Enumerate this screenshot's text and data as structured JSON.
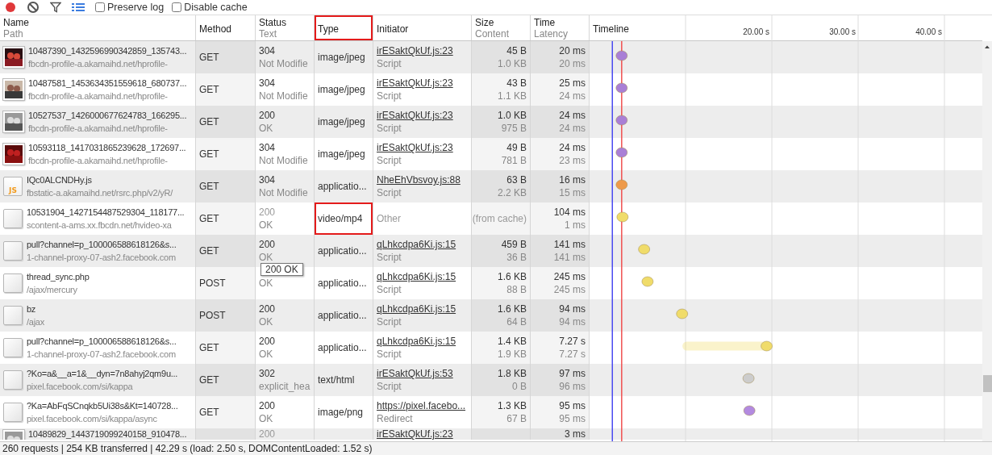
{
  "toolbar": {
    "record": {
      "on": true
    },
    "checkboxes": [
      {
        "label": "Preserve log",
        "checked": false
      },
      {
        "label": "Disable cache",
        "checked": false
      }
    ]
  },
  "columns": [
    {
      "label": "Name",
      "sublabel": "Path",
      "highlighted": false
    },
    {
      "label": "Method",
      "highlighted": false
    },
    {
      "label": "Status",
      "sublabel": "Text",
      "highlighted": false
    },
    {
      "label": "Type",
      "highlighted": true
    },
    {
      "label": "Initiator",
      "highlighted": false
    },
    {
      "label": "Size",
      "sublabel": "Content",
      "highlighted": false
    },
    {
      "label": "Time",
      "sublabel": "Latency",
      "highlighted": false
    },
    {
      "label": "Timeline",
      "highlighted": false
    }
  ],
  "rows": [
    {
      "name": "10487390_1432596990342859_135743...",
      "path": "fbcdn-profile-a.akamaihd.net/hprofile-",
      "method": "GET",
      "status": "304",
      "status_text": "Not Modifie",
      "type": {
        "text": "image/jpeg",
        "highlighted": false
      },
      "initiator": {
        "text": "irESaktQkUf.js:23",
        "link": true
      },
      "initiator_type": "Script",
      "size": "45 B",
      "content": "1.0 KB",
      "time": "20 ms",
      "latency": "20 ms",
      "cached": false,
      "color": "#a97fd6"
    },
    {
      "name": "10487581_1453634351559618_680737...",
      "path": "fbcdn-profile-a.akamaihd.net/hprofile-",
      "method": "GET",
      "status": "304",
      "status_text": "Not Modifie",
      "type": {
        "text": "image/jpeg",
        "highlighted": false
      },
      "initiator": {
        "text": "irESaktQkUf.js:23",
        "link": true
      },
      "initiator_type": "Script",
      "size": "43 B",
      "content": "1.1 KB",
      "time": "25 ms",
      "latency": "24 ms",
      "cached": false,
      "color": "#a97fd6"
    },
    {
      "name": "10527537_1426000677624783_166295...",
      "path": "fbcdn-profile-a.akamaihd.net/hprofile-",
      "method": "GET",
      "status": "200",
      "status_text": "OK",
      "type": {
        "text": "image/jpeg",
        "highlighted": false
      },
      "initiator": {
        "text": "irESaktQkUf.js:23",
        "link": true
      },
      "initiator_type": "Script",
      "size": "1.0 KB",
      "content": "975 B",
      "time": "24 ms",
      "latency": "24 ms",
      "cached": false,
      "color": "#a97fd6"
    },
    {
      "name": "10593118_1417031865239628_172697...",
      "path": "fbcdn-profile-a.akamaihd.net/hprofile-",
      "method": "GET",
      "status": "304",
      "status_text": "Not Modifie",
      "type": {
        "text": "image/jpeg",
        "highlighted": false
      },
      "initiator": {
        "text": "irESaktQkUf.js:23",
        "link": true
      },
      "initiator_type": "Script",
      "size": "49 B",
      "content": "781 B",
      "time": "24 ms",
      "latency": "23 ms",
      "cached": false,
      "color": "#a97fd6"
    },
    {
      "thumb": {
        "kind": "script",
        "label": "JS"
      },
      "name": "IQc0ALCNDHy.js",
      "path": "fbstatic-a.akamaihd.net/rsrc.php/v2/yR/",
      "method": "GET",
      "status": "304",
      "status_text": "Not Modifie",
      "type": {
        "text": "applicatio...",
        "highlighted": false
      },
      "initiator": {
        "text": "NheEhVbsvoy.js:88",
        "link": true
      },
      "initiator_type": "Script",
      "size": "63 B",
      "content": "2.2 KB",
      "time": "16 ms",
      "latency": "15 ms",
      "cached": false,
      "color": "#ee9a4a"
    },
    {
      "thumb": {
        "kind": "blank"
      },
      "name": "10531904_1427154487529304_118177...",
      "path": "scontent-a-ams.xx.fbcdn.net/hvideo-xa",
      "method": "GET",
      "status": "200",
      "status_text": "OK",
      "type": {
        "text": "video/mp4",
        "highlighted": true
      },
      "initiator": {
        "text": "Other",
        "link": false
      },
      "size": "(from cache)",
      "time": "104 ms",
      "latency": "1 ms",
      "cached": true,
      "color": "#f0dc6a"
    },
    {
      "thumb": {
        "kind": "blank"
      },
      "name": "pull?channel=p_100006588618126&s...",
      "path": "1-channel-proxy-07-ash2.facebook.com",
      "method": "GET",
      "status": "200",
      "status_text": "OK",
      "type": {
        "text": "applicatio...",
        "highlighted": false
      },
      "initiator": {
        "text": "qLhkcdpa6Ki.js:15",
        "link": true
      },
      "initiator_type": "Script",
      "size": "459 B",
      "content": "36 B",
      "time": "141 ms",
      "latency": "141 ms",
      "cached": false,
      "color": "#f0dc6a"
    },
    {
      "thumb": {
        "kind": "blank"
      },
      "name": "thread_sync.php",
      "path": "/ajax/mercury",
      "method": "POST",
      "status_text": "OK",
      "type": {
        "text": "applicatio...",
        "highlighted": false
      },
      "initiator": {
        "text": "qLhkcdpa6Ki.js:15",
        "link": true
      },
      "initiator_type": "Script",
      "size": "1.6 KB",
      "content": "88 B",
      "time": "245 ms",
      "latency": "245 ms",
      "cached": false,
      "color": "#f0dc6a"
    },
    {
      "thumb": {
        "kind": "blank"
      },
      "name": "bz",
      "path": "/ajax",
      "method": "POST",
      "status": "200",
      "status_text": "OK",
      "type": {
        "text": "applicatio...",
        "highlighted": false
      },
      "initiator": {
        "text": "qLhkcdpa6Ki.js:15",
        "link": true
      },
      "initiator_type": "Script",
      "size": "1.6 KB",
      "content": "64 B",
      "time": "94 ms",
      "latency": "94 ms",
      "cached": false,
      "color": "#f0dc6a"
    },
    {
      "thumb": {
        "kind": "blank"
      },
      "name": "pull?channel=p_100006588618126&s...",
      "path": "1-channel-proxy-07-ash2.facebook.com",
      "method": "GET",
      "status": "200",
      "status_text": "OK",
      "type": {
        "text": "applicatio...",
        "highlighted": false
      },
      "initiator": {
        "text": "qLhkcdpa6Ki.js:15",
        "link": true
      },
      "initiator_type": "Script",
      "size": "1.4 KB",
      "content": "1.9 KB",
      "time": "7.27 s",
      "latency": "7.27 s",
      "cached": false,
      "color": "#f0dc6a"
    },
    {
      "thumb": {
        "kind": "blank"
      },
      "name": "?Ko=a&__a=1&__dyn=7n8ahyj2qm9u...",
      "path": "pixel.facebook.com/si/kappa",
      "method": "GET",
      "status": "302",
      "status_text": "explicit_hea",
      "type": {
        "text": "text/html",
        "highlighted": false
      },
      "initiator": {
        "text": "irESaktQkUf.js:53",
        "link": true
      },
      "initiator_type": "Script",
      "size": "1.8 KB",
      "content": "0 B",
      "time": "97 ms",
      "latency": "96 ms",
      "cached": false,
      "color": "#cccccc"
    },
    {
      "thumb": {
        "kind": "blank"
      },
      "name": "?Ka=AbFqSCnqkb5Ui38s&Kt=140728...",
      "path": "pixel.facebook.com/si/kappa/async",
      "method": "GET",
      "status": "200",
      "status_text": "OK",
      "type": {
        "text": "image/png",
        "highlighted": false
      },
      "initiator": {
        "text": "https://pixel.facebo...",
        "link": true
      },
      "initiator_type": "Redirect",
      "size": "1.3 KB",
      "content": "67 B",
      "time": "95 ms",
      "latency": "95 ms",
      "cached": false,
      "color": "#b38ae0"
    },
    {
      "name": "10489829_1443719099240158_910478...",
      "status": "200",
      "initiator": {
        "text": "irESaktQkUf.js:23",
        "link": true
      },
      "time": "3 ms",
      "cached": true
    }
  ],
  "timeline": {
    "ticks": [
      "20.00 s",
      "30.00 s",
      "40.00 s"
    ]
  },
  "tooltip": {
    "text": "200 OK"
  },
  "status_bar": "260 requests | 254 KB transferred | 42.29 s (load: 2.50 s, DOMContentLoaded: 1.52 s)"
}
